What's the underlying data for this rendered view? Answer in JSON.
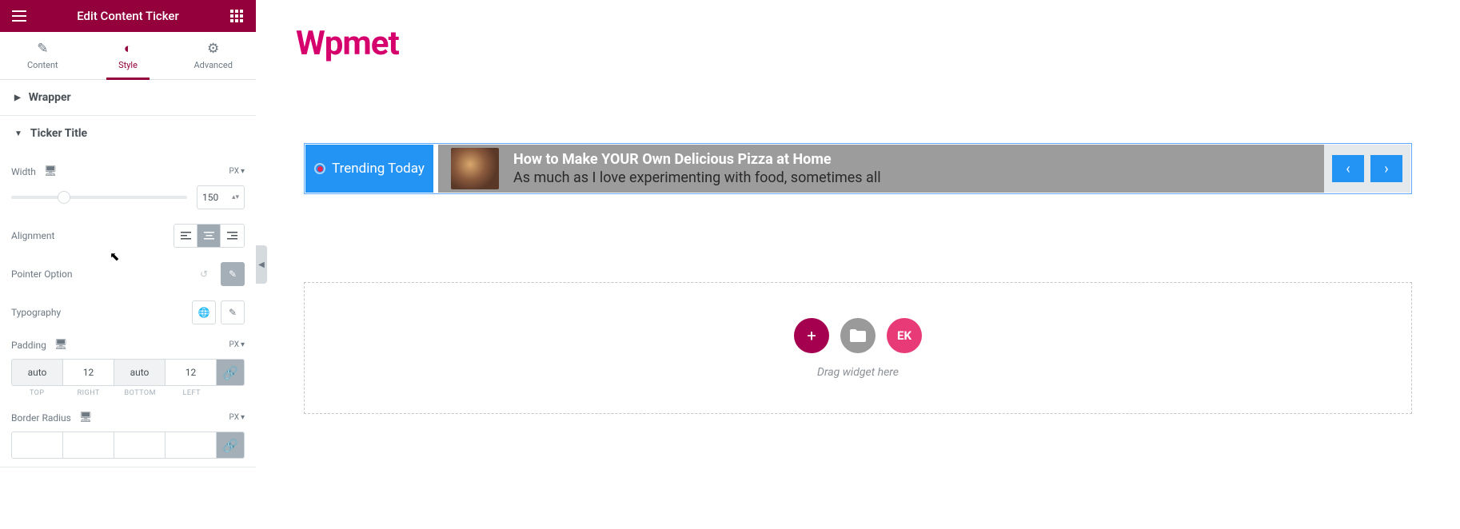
{
  "header": {
    "title": "Edit Content Ticker"
  },
  "tabs": {
    "content": "Content",
    "style": "Style",
    "advanced": "Advanced"
  },
  "sections": {
    "wrapper": "Wrapper",
    "tickerTitle": "Ticker Title"
  },
  "controls": {
    "width": {
      "label": "Width",
      "unit": "PX",
      "value": "150"
    },
    "alignment": {
      "label": "Alignment"
    },
    "pointer": {
      "label": "Pointer Option"
    },
    "typography": {
      "label": "Typography"
    },
    "padding": {
      "label": "Padding",
      "unit": "PX",
      "top": "auto",
      "right": "12",
      "bottom": "auto",
      "left": "12",
      "lblTop": "TOP",
      "lblRight": "RIGHT",
      "lblBottom": "BOTTOM",
      "lblLeft": "LEFT"
    },
    "borderRadius": {
      "label": "Border Radius",
      "unit": "PX"
    }
  },
  "canvas": {
    "brand": "Wpmet",
    "ticker": {
      "badge": "Trending Today",
      "headline": "How to Make YOUR Own Delicious Pizza at Home",
      "sub": "As much as I love experimenting with food, sometimes all"
    },
    "dropzone": {
      "text": "Drag widget here"
    }
  }
}
